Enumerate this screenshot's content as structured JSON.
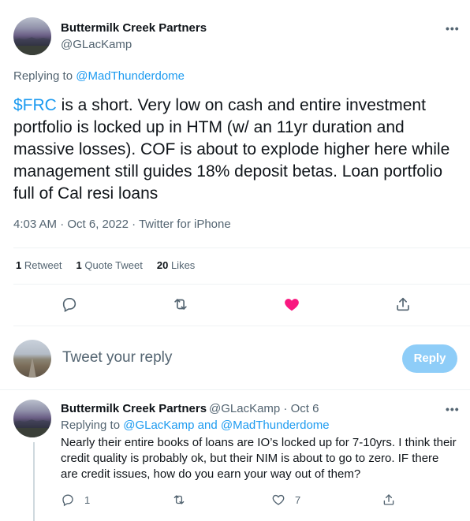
{
  "tweet": {
    "author_name": "Buttermilk Creek Partners",
    "author_handle": "@GLacKamp",
    "more_glyph": "•••",
    "replying_prefix": "Replying to ",
    "replying_to": "@MadThunderdome",
    "cashtag": "$FRC",
    "text_rest": " is a short. Very low on cash and entire investment portfolio is locked up  in HTM (w/ an 11yr duration and massive losses). COF is about to explode higher here while management still guides 18% deposit betas. Loan portfolio full of Cal resi loans",
    "timestamp": "4:03 AM · Oct 6, 2022 · Twitter for iPhone",
    "stats": {
      "retweets_count": "1",
      "retweets_label": " Retweet",
      "quote_count": "1",
      "quote_label": " Quote Tweet",
      "likes_count": "20",
      "likes_label": " Likes"
    },
    "actions": [
      "comment-icon",
      "retweet-icon",
      "heart-filled-icon",
      "share-icon"
    ],
    "liked_color": "#f91880"
  },
  "composer": {
    "placeholder": "Tweet your reply",
    "reply_button": "Reply"
  },
  "reply": {
    "author_name": "Buttermilk Creek Partners",
    "author_handle_date": "@GLacKamp · Oct 6",
    "more_glyph": "•••",
    "replying_prefix": "Replying to ",
    "replying_to": "@GLacKamp and @MadThunderdome",
    "text": "Nearly their entire books of loans are IO’s locked up for 7-10yrs. I think their credit quality is probably ok, but their NIM is about to go to zero. IF there are credit issues, how do you earn your way out of them?",
    "reply_count": "1",
    "like_count": "7"
  },
  "colors": {
    "accent": "#1d9bf0",
    "muted_text": "#536471",
    "reply_button_disabled": "#8ecdf8"
  }
}
